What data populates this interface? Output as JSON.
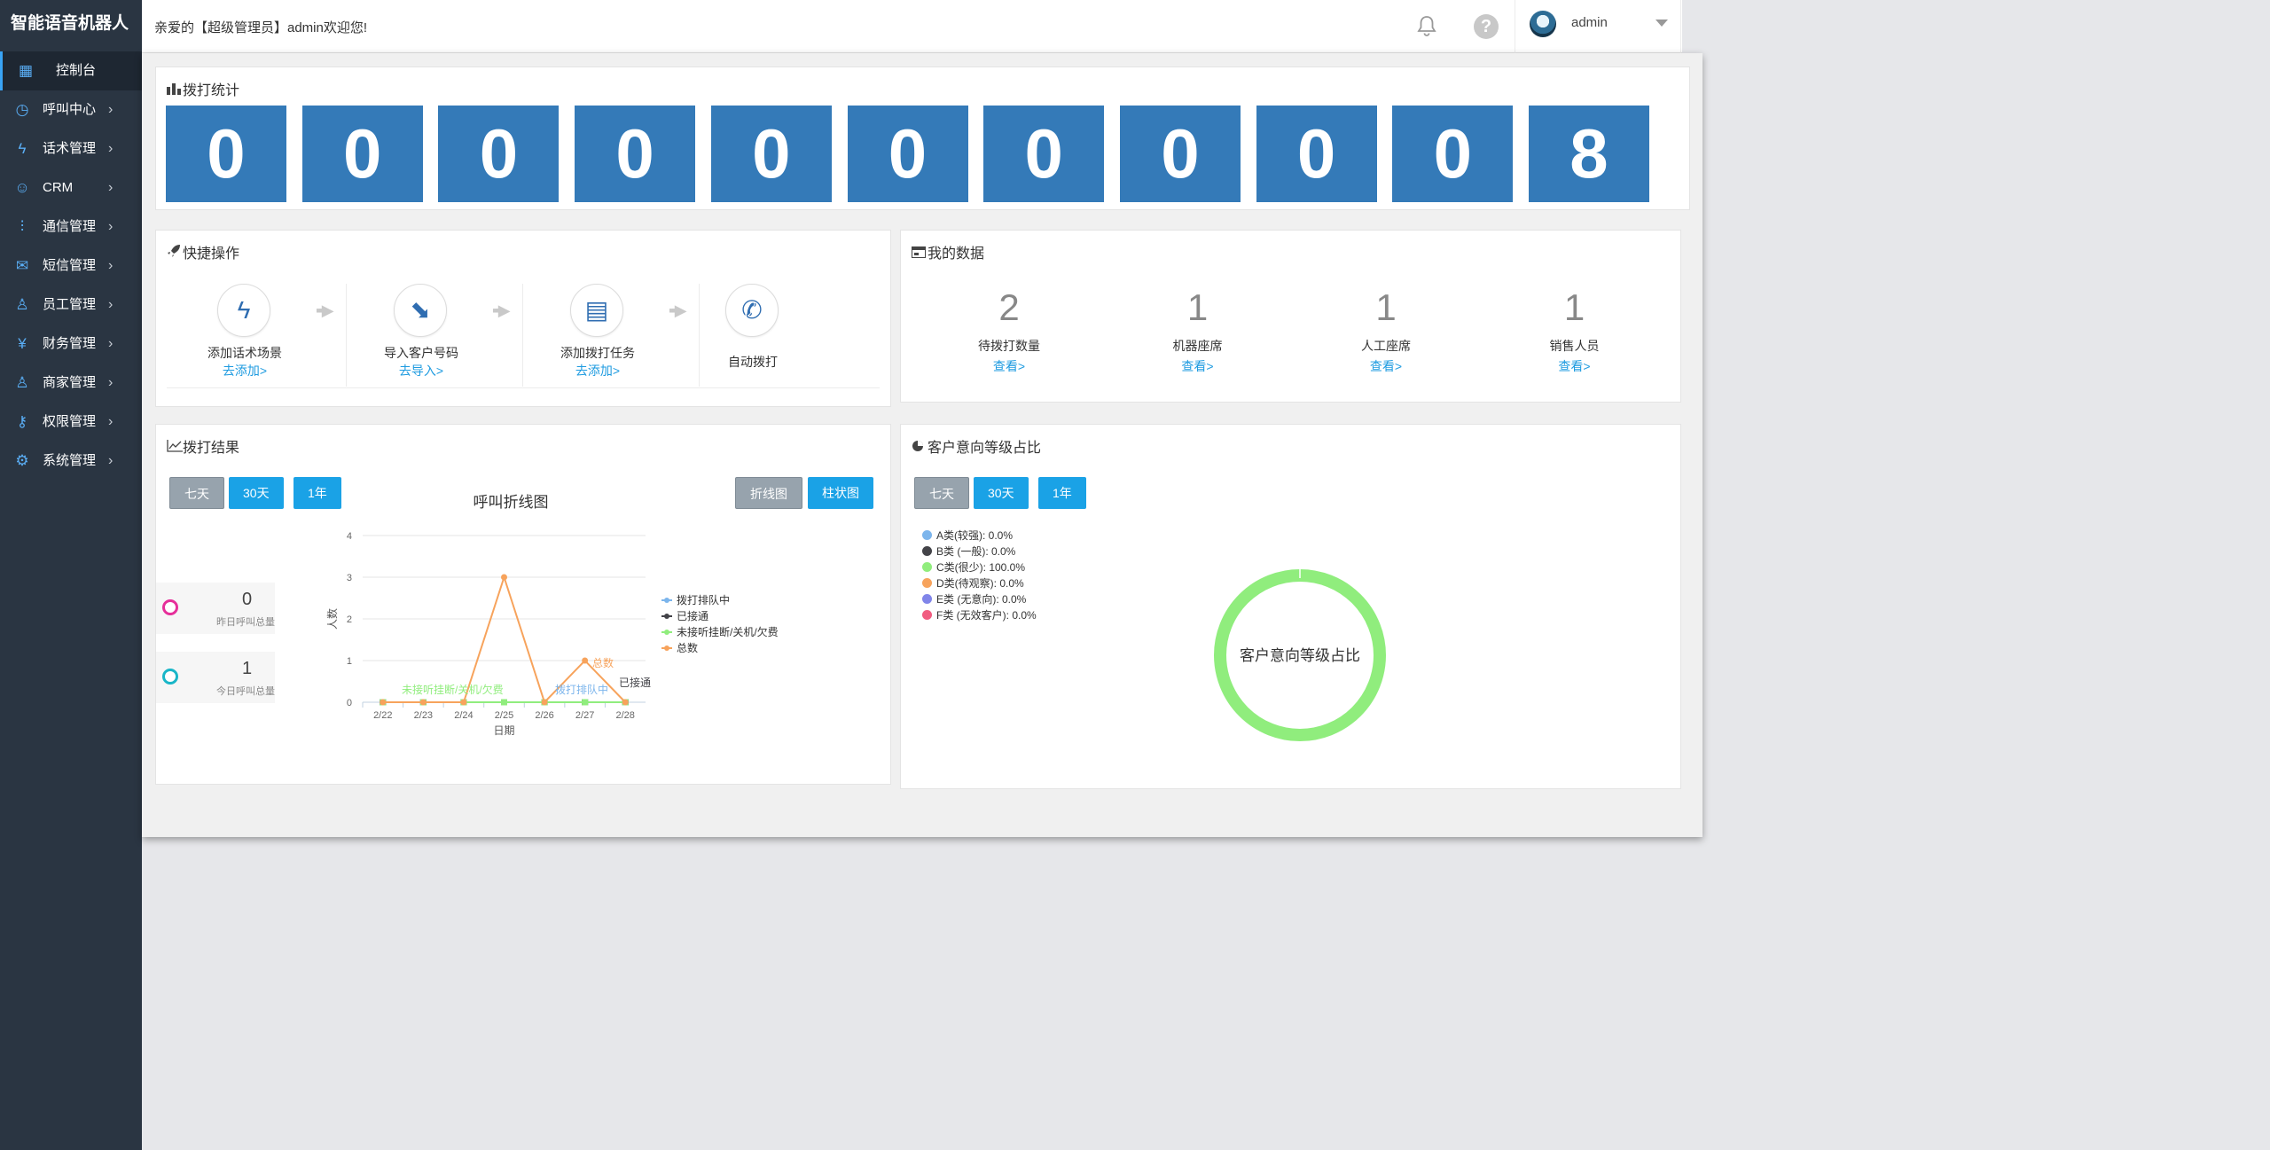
{
  "brand": "智能语音机器人",
  "sidebar": {
    "items": [
      {
        "label": "控制台",
        "icon": "dashboard-icon"
      },
      {
        "label": "呼叫中心",
        "icon": "clock-icon"
      },
      {
        "label": "话术管理",
        "icon": "bolt-icon"
      },
      {
        "label": "CRM",
        "icon": "users-icon"
      },
      {
        "label": "通信管理",
        "icon": "sliders-icon"
      },
      {
        "label": "短信管理",
        "icon": "envelope-icon"
      },
      {
        "label": "员工管理",
        "icon": "user-icon"
      },
      {
        "label": "财务管理",
        "icon": "yen-icon"
      },
      {
        "label": "商家管理",
        "icon": "user-icon"
      },
      {
        "label": "权限管理",
        "icon": "key-icon"
      },
      {
        "label": "系统管理",
        "icon": "gear-icon"
      }
    ]
  },
  "header": {
    "welcome": "亲爱的【超级管理员】admin欢迎您!",
    "username": "admin",
    "help_glyph": "?"
  },
  "stats": {
    "title": "拨打统计",
    "digits": [
      "0",
      "0",
      "0",
      "0",
      "0",
      "0",
      "0",
      "0",
      "0",
      "0",
      "8"
    ]
  },
  "quick": {
    "title": "快捷操作",
    "items": [
      {
        "label": "添加话术场景",
        "link": "去添加>",
        "icon": "bolt-icon"
      },
      {
        "label": "导入客户号码",
        "link": "去导入>",
        "icon": "import-icon"
      },
      {
        "label": "添加拨打任务",
        "link": "去添加>",
        "icon": "task-icon"
      },
      {
        "label": "自动拨打",
        "link": "",
        "icon": "phone-icon"
      }
    ]
  },
  "mydata": {
    "title": "我的数据",
    "items": [
      {
        "value": "2",
        "label": "待拨打数量",
        "link": "查看>"
      },
      {
        "value": "1",
        "label": "机器座席",
        "link": "查看>"
      },
      {
        "value": "1",
        "label": "人工座席",
        "link": "查看>"
      },
      {
        "value": "1",
        "label": "销售人员",
        "link": "查看>"
      }
    ]
  },
  "result": {
    "title": "拨打结果",
    "range_buttons": [
      "七天",
      "30天",
      "1年"
    ],
    "type_buttons": [
      "折线图",
      "柱状图"
    ],
    "side_stats": [
      {
        "value": "0",
        "label": "昨日呼叫总量"
      },
      {
        "value": "1",
        "label": "今日呼叫总量"
      }
    ]
  },
  "intent": {
    "title": "客户意向等级占比",
    "range_buttons": [
      "七天",
      "30天",
      "1年"
    ],
    "legend": [
      {
        "label": "A类(较强): 0.0%",
        "color": "#7cb5ec"
      },
      {
        "label": "B类 (一般): 0.0%",
        "color": "#434348"
      },
      {
        "label": "C类(很少): 100.0%",
        "color": "#90ed7d"
      },
      {
        "label": "D类(待观察): 0.0%",
        "color": "#f7a35c"
      },
      {
        "label": "E类 (无意向): 0.0%",
        "color": "#8085e9"
      },
      {
        "label": "F类 (无效客户): 0.0%",
        "color": "#f15c80"
      }
    ]
  },
  "chart_data": [
    {
      "type": "line",
      "title": "呼叫折线图",
      "xlabel": "日期",
      "ylabel": "人数",
      "categories": [
        "2/22",
        "2/23",
        "2/24",
        "2/25",
        "2/26",
        "2/27",
        "2/28"
      ],
      "ylim": [
        0,
        4
      ],
      "yticks": [
        0,
        1,
        2,
        3,
        4
      ],
      "grid": true,
      "legend_position": "right",
      "series": [
        {
          "name": "拨打排队中",
          "color": "#7cb5ec",
          "values": [
            0,
            0,
            0,
            0,
            0,
            0,
            0
          ]
        },
        {
          "name": "已接通",
          "color": "#434348",
          "values": [
            0,
            0,
            0,
            0,
            0,
            0,
            0
          ]
        },
        {
          "name": "未接听挂断/关机/欠费",
          "color": "#90ed7d",
          "values": [
            0,
            0,
            0,
            0,
            0,
            0,
            0
          ]
        },
        {
          "name": "总数",
          "color": "#f7a35c",
          "values": [
            0,
            0,
            0,
            3,
            0,
            1,
            0
          ]
        }
      ],
      "annotations": [
        "未接听挂断/关机/欠费",
        "拨打排队中",
        "总数",
        "已接通"
      ]
    },
    {
      "type": "pie",
      "title": "客户意向等级占比",
      "categories": [
        "A类(较强)",
        "B类 (一般)",
        "C类(很少)",
        "D类(待观察)",
        "E类 (无意向)",
        "F类 (无效客户)"
      ],
      "values": [
        0,
        0,
        100,
        0,
        0,
        0
      ],
      "colors": [
        "#7cb5ec",
        "#434348",
        "#90ed7d",
        "#f7a35c",
        "#8085e9",
        "#f15c80"
      ]
    }
  ]
}
